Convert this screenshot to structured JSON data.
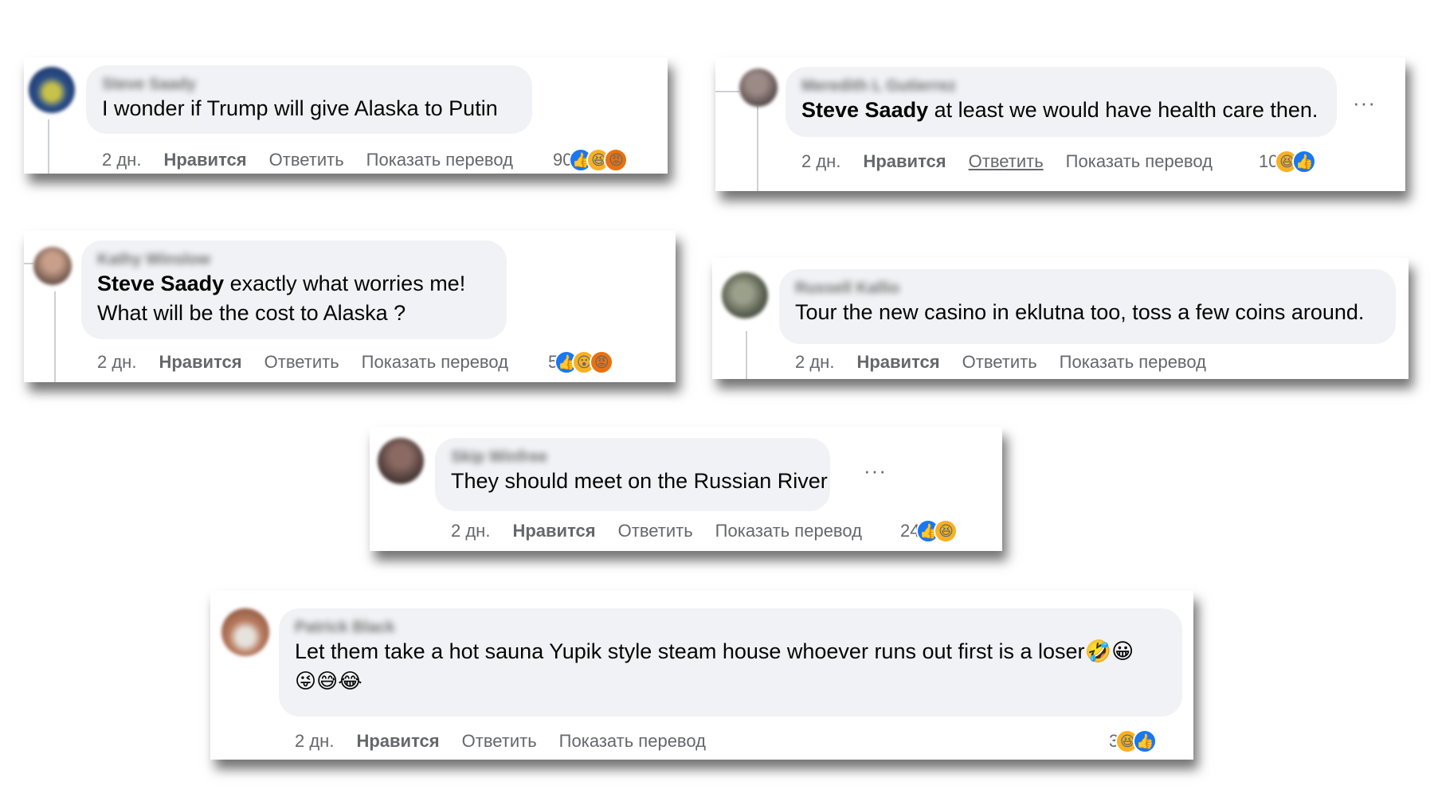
{
  "comments": [
    {
      "author": "Steve Saady",
      "mention": "",
      "text_lines": [
        "I wonder if Trump will give Alaska to Putin"
      ],
      "time": "2 дн.",
      "like": "Нравится",
      "reply": "Ответить",
      "translate": "Показать перевод",
      "reaction_count": "90",
      "reactions": [
        "like-icon",
        "haha-icon",
        "angry-icon"
      ]
    },
    {
      "author": "Meredith L Gutierrez",
      "mention": "Steve Saady",
      "text_lines": [
        " at least we would have health care then."
      ],
      "time": "2 дн.",
      "like": "Нравится",
      "reply": "Ответить",
      "translate": "Показать перевод",
      "reaction_count": "10",
      "reactions": [
        "haha-icon",
        "like-icon"
      ],
      "more": "···"
    },
    {
      "author": "Kathy Winslow",
      "mention": "Steve Saady",
      "text_lines": [
        " exactly what worries me!",
        "What will be the cost to Alaska ?"
      ],
      "time": "2 дн.",
      "like": "Нравится",
      "reply": "Ответить",
      "translate": "Показать перевод",
      "reaction_count": "5",
      "reactions": [
        "like-icon",
        "wow-icon",
        "angry-icon"
      ]
    },
    {
      "author": "Russell Kallio",
      "mention": "",
      "text_lines": [
        "Tour the new casino in eklutna too, toss a few coins around."
      ],
      "time": "2 дн.",
      "like": "Нравится",
      "reply": "Ответить",
      "translate": "Показать перевод"
    },
    {
      "author": "Skip Winfree",
      "mention": "",
      "text_lines": [
        "They should meet on the Russian River"
      ],
      "time": "2 дн.",
      "like": "Нравится",
      "reply": "Ответить",
      "translate": "Показать перевод",
      "reaction_count": "24",
      "reactions": [
        "like-icon",
        "haha-icon"
      ],
      "more": "···"
    },
    {
      "author": "Patrick Black",
      "mention": "",
      "text_lines": [
        "Let them take a hot sauna Yupik style steam house whoever runs out first is a loser🤣😀",
        "😜😅😂"
      ],
      "time": "2 дн.",
      "like": "Нравится",
      "reply": "Ответить",
      "translate": "Показать перевод",
      "reaction_count": "3",
      "reactions": [
        "haha-icon",
        "like-icon"
      ]
    }
  ],
  "colors": {
    "bubble": "#f0f2f5",
    "meta_text": "#65676b",
    "like_blue": "#1877f2",
    "haha_yellow": "#f7b125",
    "angry_orange": "#e9710f"
  }
}
